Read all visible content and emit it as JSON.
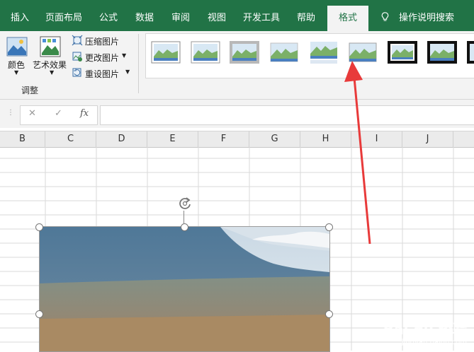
{
  "tabs": [
    {
      "label": "插入",
      "active": false
    },
    {
      "label": "页面布局",
      "active": false
    },
    {
      "label": "公式",
      "active": false
    },
    {
      "label": "数据",
      "active": false
    },
    {
      "label": "审阅",
      "active": false
    },
    {
      "label": "视图",
      "active": false
    },
    {
      "label": "开发工具",
      "active": false
    },
    {
      "label": "帮助",
      "active": false
    },
    {
      "label": "格式",
      "active": true
    }
  ],
  "search": {
    "label": "操作说明搜索",
    "icon": "lightbulb-icon"
  },
  "ribbon": {
    "color_label": "颜色",
    "artistic_label": "艺术效果",
    "compress_label": "压缩图片",
    "change_label": "更改图片",
    "reset_label": "重设图片",
    "group_adjust": "调整"
  },
  "formula_bar": {
    "cancel": "✕",
    "enter": "✓",
    "fx": "fx",
    "value": ""
  },
  "columns": [
    "B",
    "C",
    "D",
    "E",
    "F",
    "G",
    "H",
    "I",
    "J"
  ],
  "watermark": {
    "text": "Bai du 经验",
    "sub": "jingyan.baidu.com"
  },
  "colors": {
    "accent": "#217346",
    "arrow": "#e83a3a"
  }
}
